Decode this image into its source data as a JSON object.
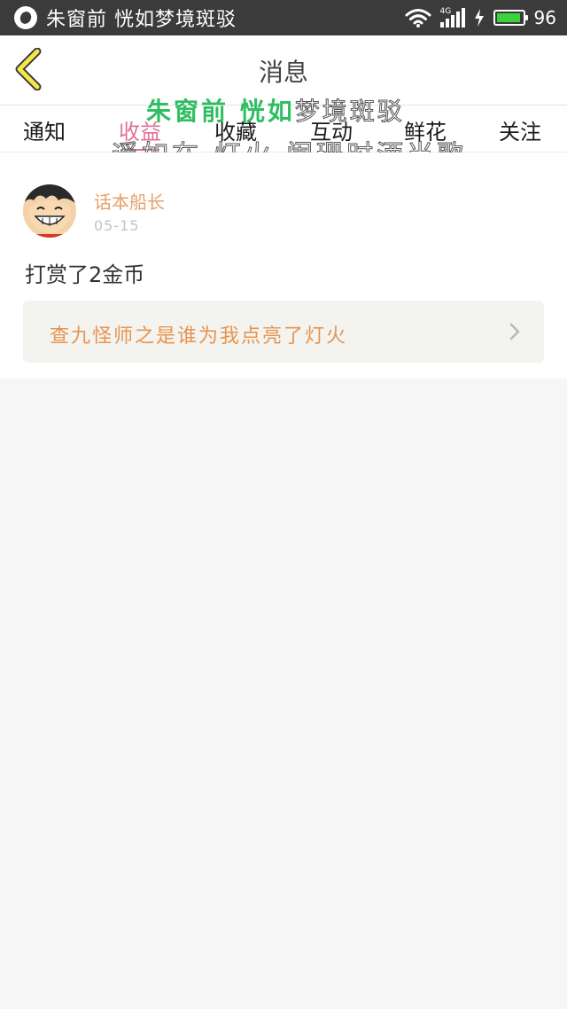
{
  "status_bar": {
    "carrier": "朱窗前 恍如梦境斑驳",
    "network": "4G",
    "battery": "96",
    "battery_level": 0.96
  },
  "header": {
    "title": "消息"
  },
  "tabs": [
    {
      "label": "通知"
    },
    {
      "label": "收益",
      "active": true
    },
    {
      "label": "收藏"
    },
    {
      "label": "互动"
    },
    {
      "label": "鲜花"
    },
    {
      "label": "关注"
    }
  ],
  "overlay": {
    "line1_green": "朱窗前 恍如",
    "line1_outline": "梦境斑驳",
    "line2": "遥如在 灯火 阑珊时酒当歌"
  },
  "message": {
    "sender": "话本船长",
    "date": "05-15",
    "text": "打赏了2金币",
    "link_text": "查九怪师之是谁为我点亮了灯火"
  },
  "colors": {
    "accent_tab": "#e0709b",
    "sender": "#e6a06b",
    "link": "#e8944f",
    "back_chevron": "#f5e74a"
  },
  "icons": {
    "back": "chevron-left-icon",
    "link_arrow": "chevron-right-icon",
    "wifi": "wifi-icon",
    "signal": "signal-icon",
    "charging": "bolt-icon",
    "battery": "battery-icon"
  }
}
